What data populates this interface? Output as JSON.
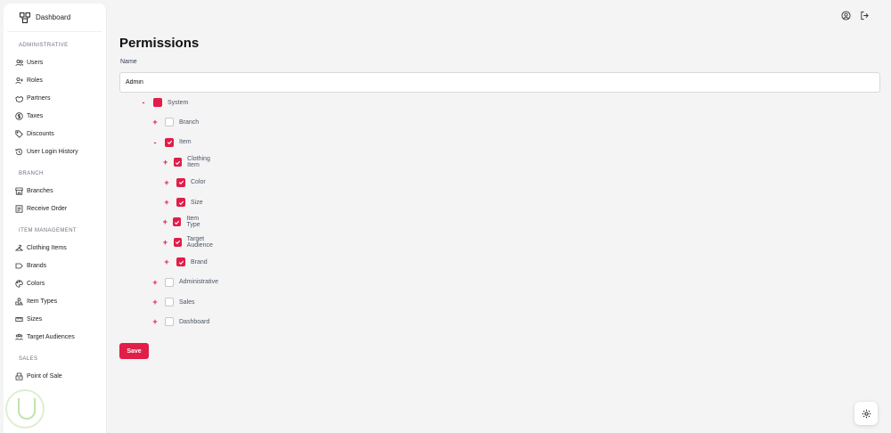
{
  "sidebar": {
    "brand_label": "Dashboard",
    "sections": [
      {
        "title": "ADMINISTRATIVE",
        "items": [
          {
            "label": "Users",
            "icon": "users-icon"
          },
          {
            "label": "Roles",
            "icon": "user-plus-icon"
          },
          {
            "label": "Partners",
            "icon": "handshake-icon"
          },
          {
            "label": "Taxes",
            "icon": "dollar-circle-icon"
          },
          {
            "label": "Discounts",
            "icon": "tag-icon"
          },
          {
            "label": "User Login History",
            "icon": "history-icon"
          }
        ]
      },
      {
        "title": "BRANCH",
        "items": [
          {
            "label": "Branches",
            "icon": "store-icon"
          },
          {
            "label": "Receive Order",
            "icon": "receipt-icon"
          }
        ]
      },
      {
        "title": "ITEM MANAGEMENT",
        "items": [
          {
            "label": "Clothing Items",
            "icon": "hanger-icon"
          },
          {
            "label": "Brands",
            "icon": "brand-tag-icon"
          },
          {
            "label": "Colors",
            "icon": "palette-icon"
          },
          {
            "label": "Item Types",
            "icon": "shapes-icon"
          },
          {
            "label": "Sizes",
            "icon": "ruler-icon"
          },
          {
            "label": "Target Audiences",
            "icon": "audience-icon"
          }
        ]
      },
      {
        "title": "SALES",
        "items": [
          {
            "label": "Point of Sale",
            "icon": "register-icon"
          }
        ]
      }
    ]
  },
  "main": {
    "title": "Permissions",
    "name_label": "Name",
    "name_value": "Admin",
    "save_label": "Save"
  },
  "tree": [
    {
      "label": "System",
      "toggle": "-",
      "state": "partial",
      "level": 0
    },
    {
      "label": "Branch",
      "toggle": "+",
      "state": "off",
      "level": 1
    },
    {
      "label": "Item",
      "toggle": "-",
      "state": "on",
      "level": 1
    },
    {
      "label": "Clothing Item",
      "toggle": "+",
      "state": "on",
      "level": 2
    },
    {
      "label": "Color",
      "toggle": "+",
      "state": "on",
      "level": 2
    },
    {
      "label": "Size",
      "toggle": "+",
      "state": "on",
      "level": 2
    },
    {
      "label": "Item Type",
      "toggle": "+",
      "state": "on",
      "level": 2
    },
    {
      "label": "Target Audience",
      "toggle": "+",
      "state": "on",
      "level": 2
    },
    {
      "label": "Brand",
      "toggle": "+",
      "state": "on",
      "level": 2
    },
    {
      "label": "Administrative",
      "toggle": "+",
      "state": "off",
      "level": 1
    },
    {
      "label": "Sales",
      "toggle": "+",
      "state": "off",
      "level": 1
    },
    {
      "label": "Dashboard",
      "toggle": "+",
      "state": "off",
      "level": 1
    }
  ],
  "colors": {
    "accent": "#e11d48"
  }
}
